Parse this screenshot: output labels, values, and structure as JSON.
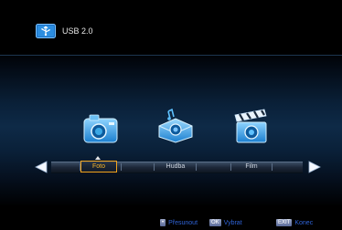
{
  "header": {
    "title": "USB 2.0",
    "icon": "usb-drive-icon"
  },
  "menu": {
    "items": [
      {
        "label": "Foto",
        "icon": "camera-icon",
        "selected": true
      },
      {
        "label": "Hudba",
        "icon": "music-speaker-icon",
        "selected": false
      },
      {
        "label": "Film",
        "icon": "film-clapper-icon",
        "selected": false
      }
    ],
    "left_arrow": "left-arrow-icon",
    "right_arrow": "right-arrow-icon"
  },
  "footer": {
    "move": {
      "key": "•",
      "label": "Přesunout"
    },
    "ok": {
      "key": "OK",
      "label": "Vybrat"
    },
    "exit": {
      "key": "EXIT",
      "label": "Konec"
    }
  },
  "colors": {
    "accent": "#f1a41f",
    "hint": "#2f63d6",
    "icon_blue": "#3aa8e6"
  }
}
